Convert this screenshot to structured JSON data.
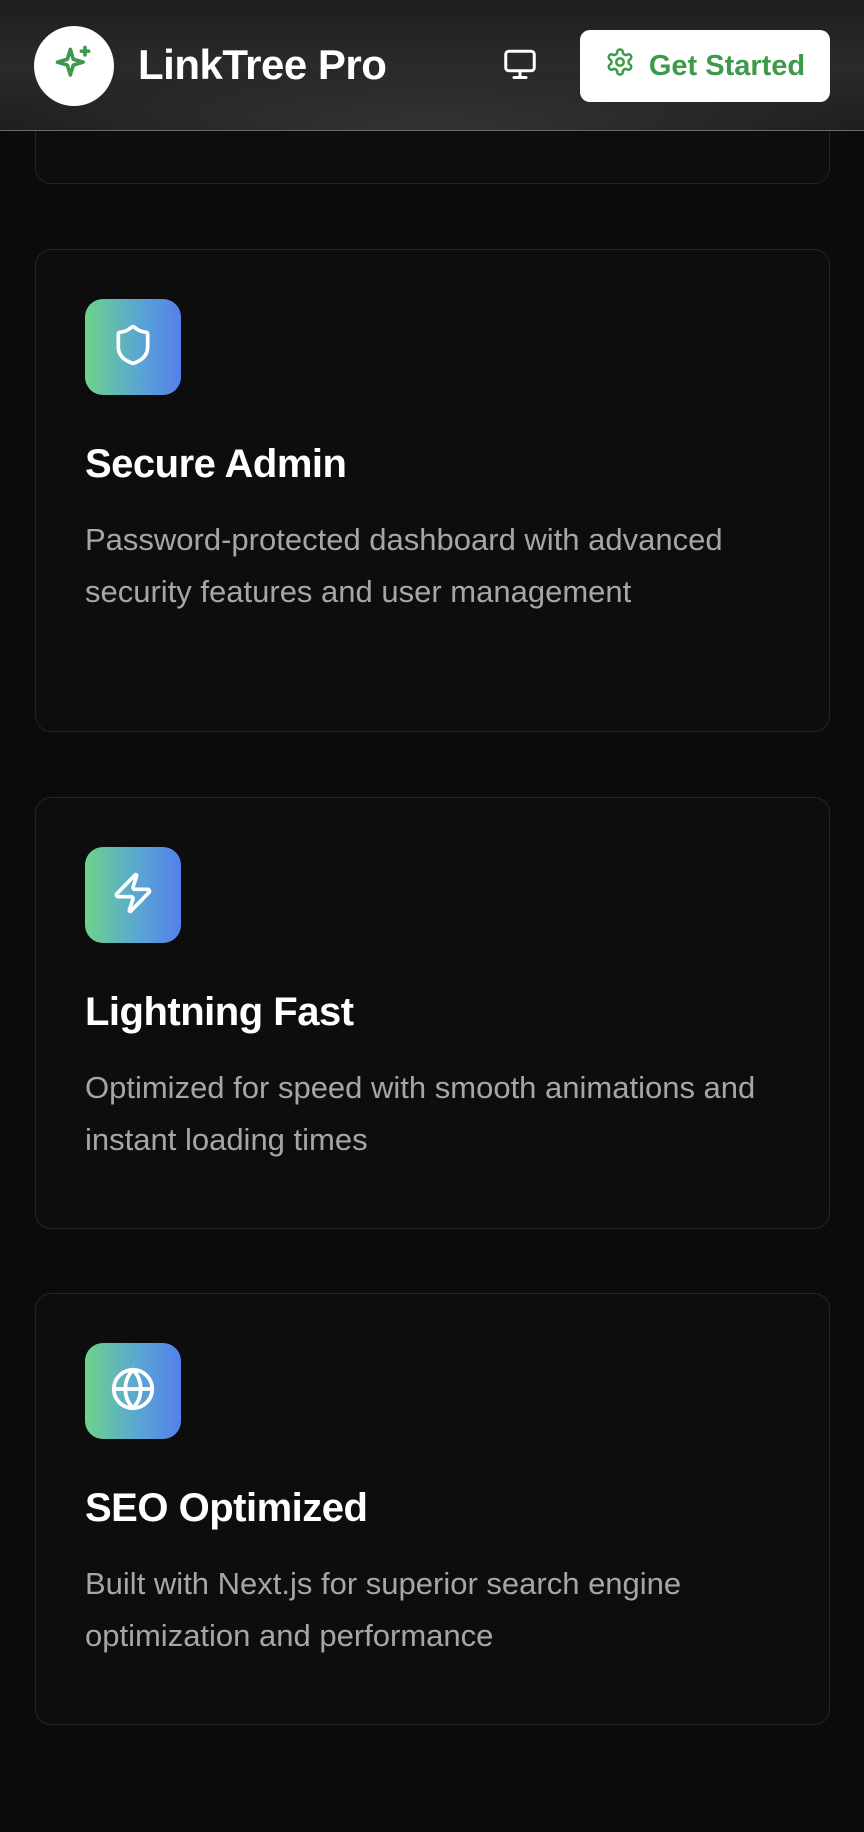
{
  "header": {
    "brand": "LinkTree Pro",
    "logo_icon": "sparkles-icon",
    "display_toggle_icon": "monitor-icon",
    "cta_label": "Get Started",
    "cta_icon": "gear-icon",
    "accent_color": "#3d9a4a"
  },
  "features": [
    {
      "icon": "shield-icon",
      "title": "Secure Admin",
      "description": "Password-protected dashboard with advanced security features and user management"
    },
    {
      "icon": "lightning-icon",
      "title": "Lightning Fast",
      "description": "Optimized for speed with smooth animations and instant loading times"
    },
    {
      "icon": "globe-icon",
      "title": "SEO Optimized",
      "description": "Built with Next.js for superior search engine optimization and performance"
    }
  ],
  "colors": {
    "background": "#0b0b0b",
    "icon_gradient_start": "#6dd38a",
    "icon_gradient_end": "#5480ec",
    "description_text": "#a6a6a6"
  }
}
